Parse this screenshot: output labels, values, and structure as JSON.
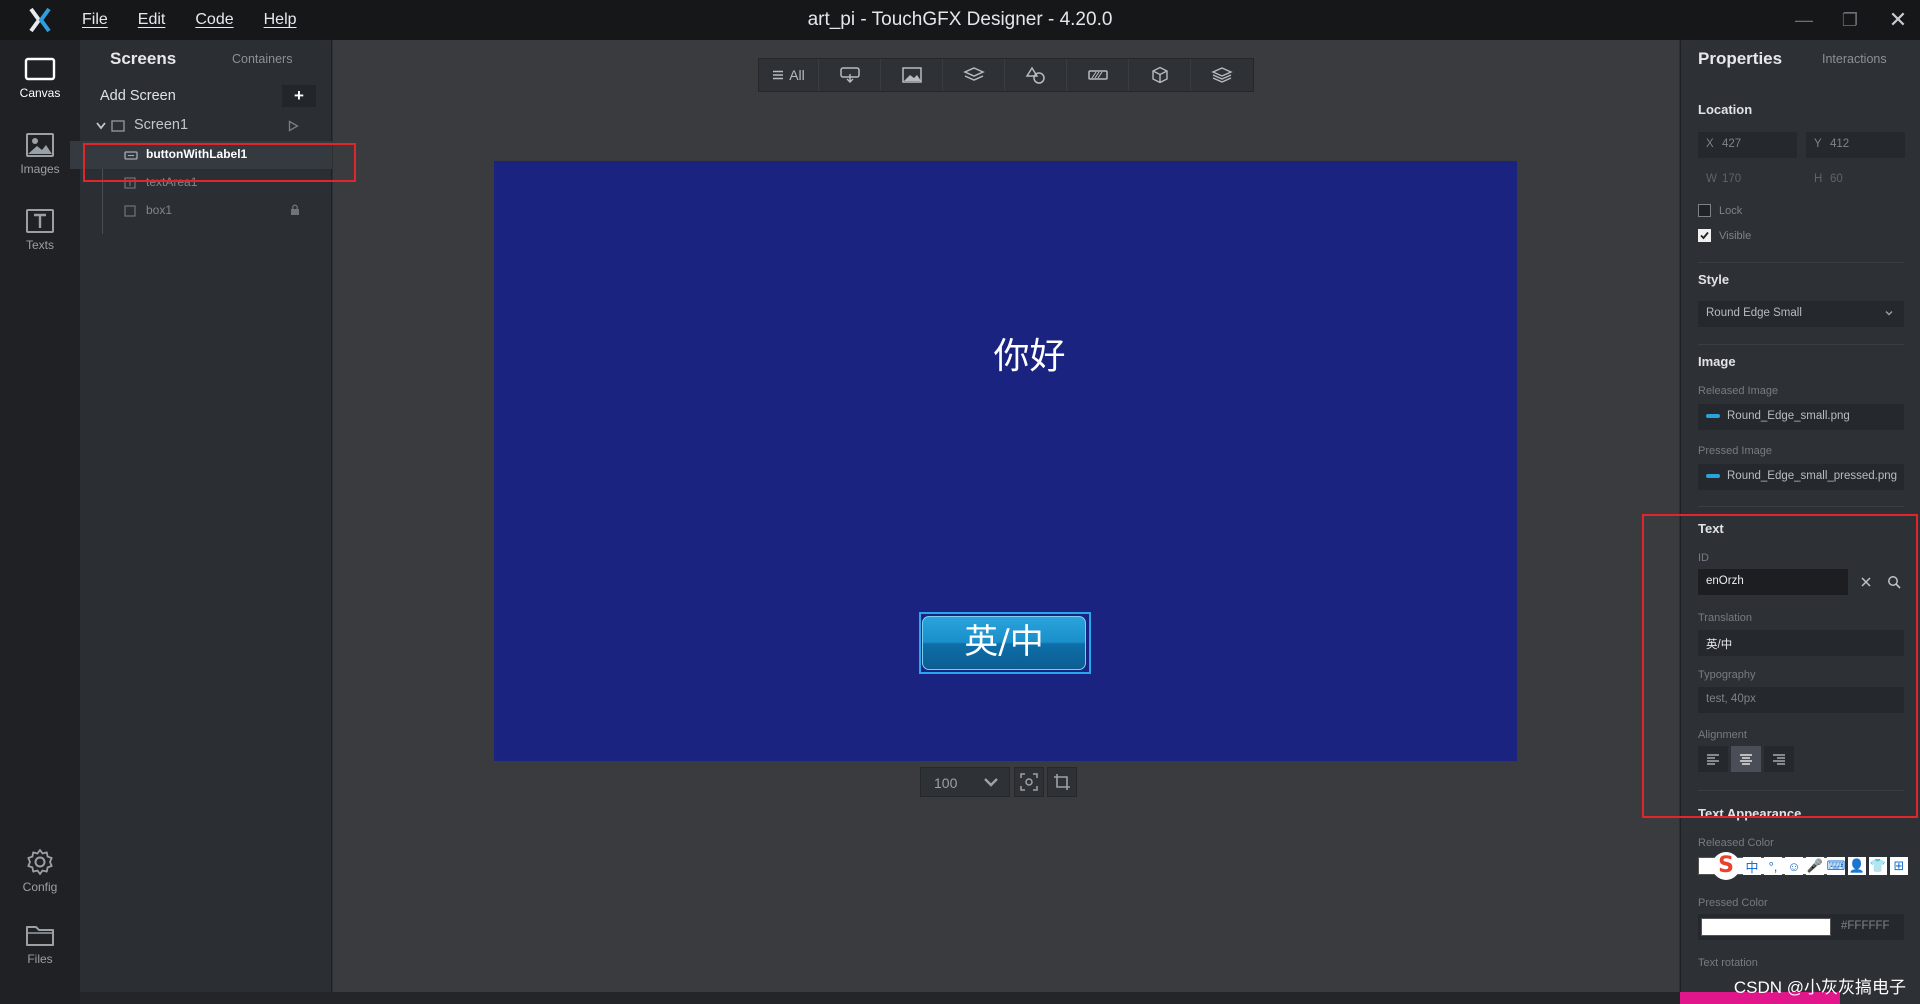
{
  "app": {
    "title": "art_pi - TouchGFX Designer - 4.20.0",
    "menu": [
      "File",
      "Edit",
      "Code",
      "Help"
    ],
    "window_controls": {
      "minimize": "—",
      "maximize": "❐",
      "close": "✕"
    }
  },
  "left_nav": {
    "items": [
      {
        "label": "Canvas",
        "icon": "canvas-icon",
        "active": true
      },
      {
        "label": "Images",
        "icon": "image-icon",
        "active": false
      },
      {
        "label": "Texts",
        "icon": "text-icon",
        "active": false
      },
      {
        "label": "Config",
        "icon": "gear-icon",
        "active": false
      },
      {
        "label": "Files",
        "icon": "folder-icon",
        "active": false
      }
    ]
  },
  "screens_panel": {
    "tab_active": "Screens",
    "tab_inactive": "Containers",
    "add_screen_label": "Add Screen",
    "add_screen_button": "+",
    "screen_name": "Screen1",
    "widgets": [
      {
        "name": "buttonWithLabel1",
        "icon": "button-icon",
        "selected": true
      },
      {
        "name": "textArea1",
        "icon": "text-area-icon",
        "selected": false
      },
      {
        "name": "box1",
        "icon": "box-icon",
        "selected": false,
        "locked": true
      }
    ]
  },
  "canvas": {
    "toolbar": {
      "all_label": "All",
      "filters": [
        "button-filter-icon",
        "image-filter-icon",
        "container-filter-icon",
        "shapes-filter-icon",
        "progress-filter-icon",
        "3d-filter-icon",
        "layers-filter-icon"
      ]
    },
    "stage_color": "#1a237f",
    "text_area": "你好",
    "button_label": "英/中",
    "zoom": "100"
  },
  "properties": {
    "tab_active": "Properties",
    "tab_inactive": "Interactions",
    "location": {
      "title": "Location",
      "x_label": "X",
      "x_value": "427",
      "y_label": "Y",
      "y_value": "412",
      "w_label": "W",
      "w_value": "170",
      "h_label": "H",
      "h_value": "60",
      "lock_label": "Lock",
      "lock_checked": false,
      "visible_label": "Visible",
      "visible_checked": true
    },
    "style": {
      "title": "Style",
      "value": "Round Edge Small"
    },
    "image": {
      "title": "Image",
      "released_label": "Released Image",
      "released_value": "Round_Edge_small.png",
      "pressed_label": "Pressed Image",
      "pressed_value": "Round_Edge_small_pressed.png"
    },
    "text": {
      "title": "Text",
      "id_label": "ID",
      "id_value": "enOrzh",
      "translation_label": "Translation",
      "translation_value": "英/中",
      "typography_label": "Typography",
      "typography_value": "test, 40px",
      "alignment_label": "Alignment",
      "alignment_selected": "center"
    },
    "text_appearance": {
      "title": "Text Appearance",
      "released_color_label": "Released Color",
      "pressed_color_label": "Pressed Color",
      "pressed_color_value": "#FFFFFF",
      "text_rotation_label": "Text rotation"
    }
  },
  "overlay": {
    "ime_logo": "S",
    "ime_items": [
      "中",
      "°,",
      "☺",
      "🎤",
      "⌨",
      "👤",
      "👕",
      "⊞"
    ],
    "watermark": "CSDN @小灰灰搞电子"
  },
  "colors": {
    "highlight": "#e0262a",
    "accent": "#29a7ee",
    "button": "#1a8fca"
  }
}
